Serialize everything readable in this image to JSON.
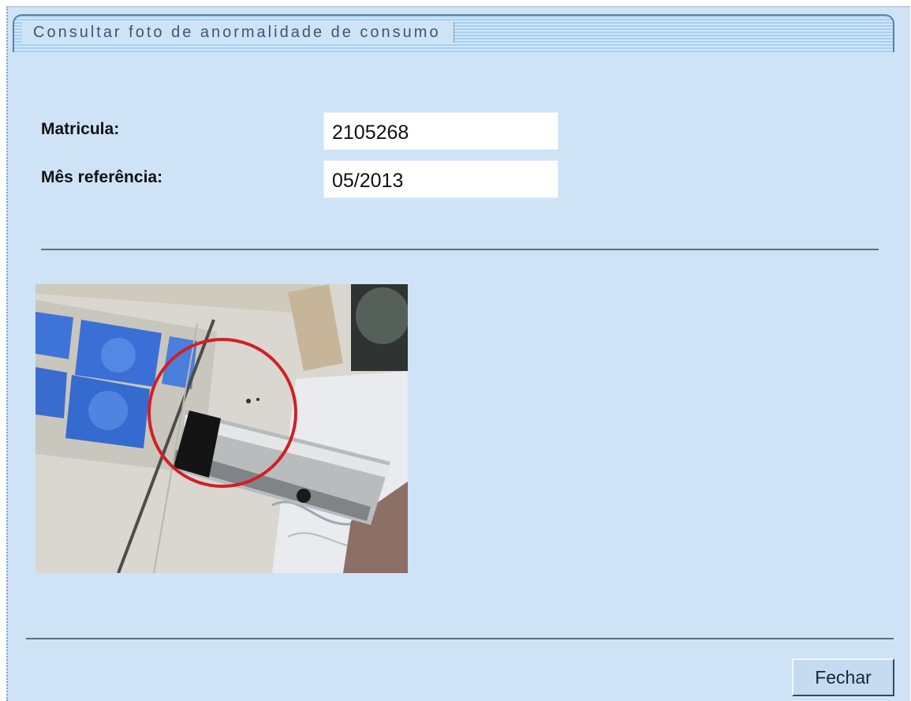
{
  "window": {
    "title": "Consultar foto de anormalidade de consumo"
  },
  "form": {
    "matricula_label": "Matricula:",
    "matricula_value": "2105268",
    "mes_label": "Mês referência:",
    "mes_value": "05/2013"
  },
  "photo": {
    "description_icon": "meter-photo-image",
    "highlight_color": "#d21f26"
  },
  "footer": {
    "close_label": "Fechar"
  }
}
